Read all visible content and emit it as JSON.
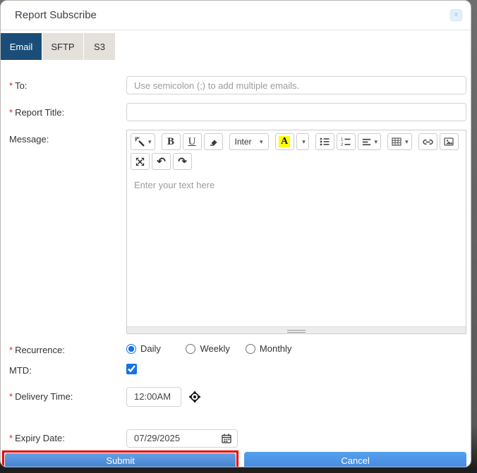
{
  "dialog": {
    "title": "Report Subscribe"
  },
  "tabs": [
    {
      "label": "Email",
      "active": true
    },
    {
      "label": "SFTP",
      "active": false
    },
    {
      "label": "S3",
      "active": false
    }
  ],
  "ui": {
    "required_marker": "*"
  },
  "form": {
    "to": {
      "label": "To:",
      "required": true,
      "value": "",
      "placeholder": "Use semicolon (;) to add multiple emails."
    },
    "report_title": {
      "label": "Report Title:",
      "required": true,
      "value": "",
      "placeholder": ""
    },
    "message": {
      "label": "Message:",
      "placeholder": "Enter your text here"
    },
    "recurrence": {
      "label": "Recurrence:",
      "required": true,
      "options": [
        {
          "label": "Daily",
          "selected": true
        },
        {
          "label": "Weekly",
          "selected": false
        },
        {
          "label": "Monthly",
          "selected": false
        }
      ]
    },
    "mtd": {
      "label": "MTD:",
      "checked": true
    },
    "delivery_time": {
      "label": "Delivery Time:",
      "required": true,
      "value": "12:00AM"
    },
    "expiry_date": {
      "label": "Expiry Date:",
      "required": true,
      "value": "07/29/2025"
    }
  },
  "editor_toolbar": {
    "bold_label": "B",
    "underline_label": "U",
    "font_name": "Inter",
    "color_letter": "A",
    "caret": "▾",
    "undo_glyph": "↶",
    "redo_glyph": "↷"
  },
  "buttons": {
    "submit": "Submit",
    "cancel": "Cancel"
  },
  "icons": {
    "close": "×"
  },
  "colors": {
    "active_tab": "#1a4e78",
    "inactive_tab": "#e4e1dc",
    "primary_button": "#4a90dd",
    "annotation_red": "#e80000",
    "control_accent": "#1673e6",
    "highlight_yellow": "#ffff00",
    "required_red": "#e02020"
  }
}
